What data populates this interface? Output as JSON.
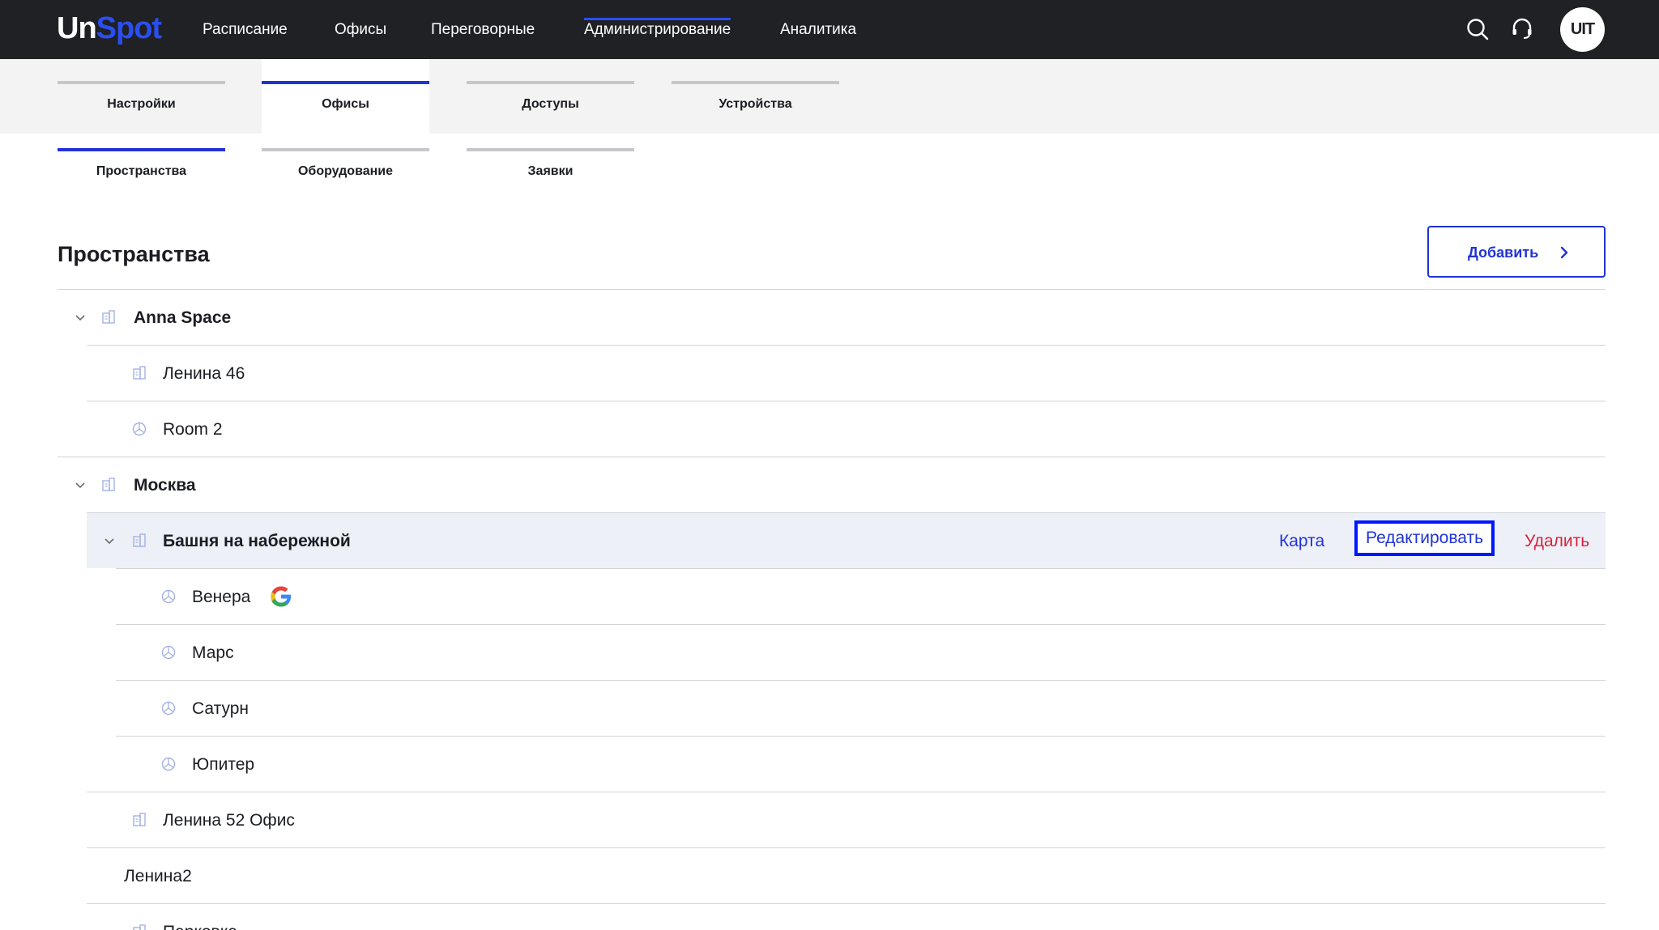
{
  "app": {
    "logo_part1": "Un",
    "logo_part2": "Spot"
  },
  "nav": [
    {
      "label": "Расписание"
    },
    {
      "label": "Офисы"
    },
    {
      "label": "Переговорные"
    },
    {
      "label": "Администрирование",
      "active": true
    },
    {
      "label": "Аналитика"
    }
  ],
  "header_icons": [
    "search-icon",
    "headset-icon"
  ],
  "user": {
    "avatar_text": "UIT"
  },
  "tabs": [
    {
      "label": "Настройки"
    },
    {
      "label": "Офисы",
      "active": true
    },
    {
      "label": "Доступы"
    },
    {
      "label": "Устройства"
    }
  ],
  "subtabs": [
    {
      "label": "Пространства",
      "active": true
    },
    {
      "label": "Оборудование"
    },
    {
      "label": "Заявки"
    }
  ],
  "page": {
    "title": "Пространства",
    "add_label": "Добавить"
  },
  "row_actions": {
    "map": "Карта",
    "edit": "Редактировать",
    "delete": "Удалить"
  },
  "tree": [
    {
      "name": "Anna Space",
      "level": 0,
      "type": "building",
      "expanded": true
    },
    {
      "name": "Ленина 46",
      "level": 1,
      "type": "building"
    },
    {
      "name": "Room 2",
      "level": 1,
      "type": "room"
    },
    {
      "name": "Москва",
      "level": 0,
      "type": "building",
      "expanded": true
    },
    {
      "name": "Башня на набережной",
      "level": 1,
      "type": "building",
      "expanded": true,
      "selected": true
    },
    {
      "name": "Венера",
      "level": 2,
      "type": "room",
      "badge": "google-icon"
    },
    {
      "name": "Марс",
      "level": 2,
      "type": "room"
    },
    {
      "name": "Сатурн",
      "level": 2,
      "type": "room"
    },
    {
      "name": "Юпитер",
      "level": 2,
      "type": "room"
    },
    {
      "name": "Ленина 52 Офис",
      "level": 1,
      "type": "building"
    },
    {
      "name": "Ленина2",
      "level": 1,
      "type": "none"
    },
    {
      "name": "Парковка",
      "level": 1,
      "type": "building"
    }
  ],
  "colors": {
    "accent": "#2033d6",
    "danger": "#d9223a",
    "topbar": "#1f2125",
    "highlight_row": "#eef0f8"
  }
}
